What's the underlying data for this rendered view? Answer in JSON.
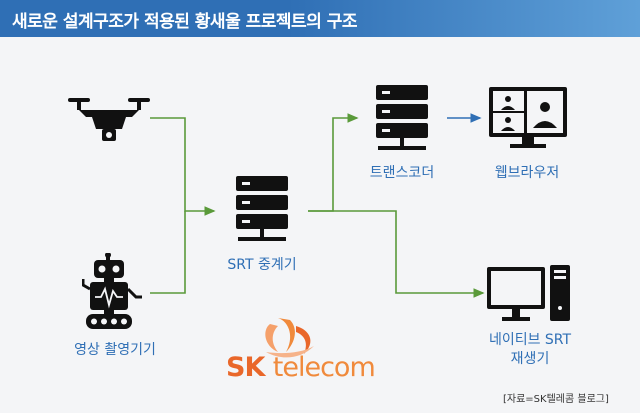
{
  "title": "새로운 설계구조가 적용된 황새울 프로젝트의 구조",
  "nodes": {
    "capture": "영상 촬영기기",
    "relay": "SRT 중계기",
    "transcoder": "트랜스코더",
    "browser": "웹브라우저",
    "native": [
      "네이티브 SRT",
      "재생기"
    ]
  },
  "logo": {
    "sk": "SK",
    "telecom": "telecom"
  },
  "source": "[자료=SK텔레콤 블로그]",
  "colors": {
    "accent": "#2f6fb5",
    "line": "#5a9a3a",
    "arrow": "#2f6fb5",
    "brand": "#e9672a"
  },
  "icons": [
    "drone-icon",
    "robot-camera-icon",
    "server-icon",
    "video-conference-icon",
    "desktop-computer-icon",
    "sk-logo-icon"
  ]
}
